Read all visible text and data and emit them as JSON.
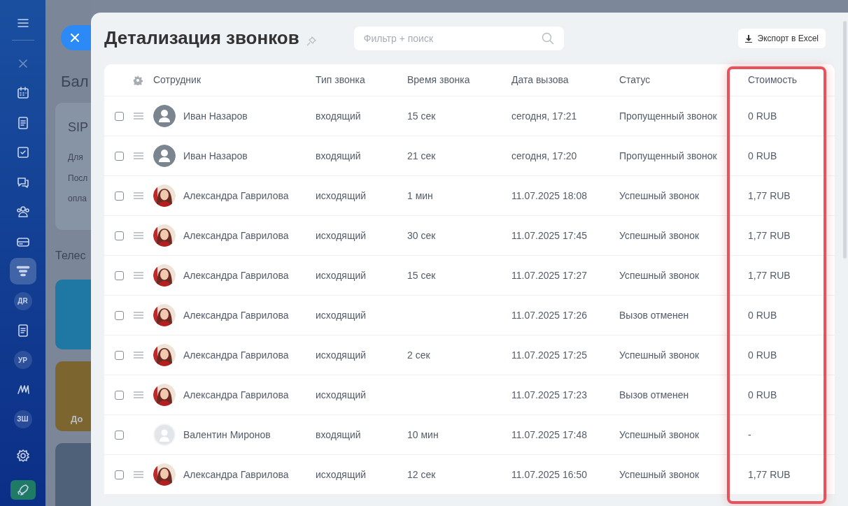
{
  "sidebar": {
    "items": [
      {
        "kind": "menu",
        "selected": false
      },
      {
        "kind": "close",
        "selected": false
      },
      {
        "kind": "calendar",
        "selected": false
      },
      {
        "kind": "document",
        "selected": false
      },
      {
        "kind": "checkbox",
        "selected": false
      },
      {
        "kind": "chat",
        "selected": false
      },
      {
        "kind": "people",
        "selected": false
      },
      {
        "kind": "card",
        "selected": false
      },
      {
        "kind": "funnel",
        "selected": true
      },
      {
        "kind": "initials",
        "text": "ДR",
        "selected": false
      },
      {
        "kind": "document",
        "selected": false
      },
      {
        "kind": "initials",
        "text": "УР",
        "selected": false
      },
      {
        "kind": "wave",
        "selected": false
      },
      {
        "kind": "initials",
        "text": "ЗШ",
        "selected": false
      },
      {
        "kind": "settings",
        "selected": false
      },
      {
        "kind": "rocket",
        "selected": false
      }
    ]
  },
  "background_page": {
    "title": "Бал",
    "card": {
      "title": "SIP",
      "lines": [
        "Для",
        "Посл",
        "опла"
      ]
    },
    "section_title": "Телес",
    "tiles": [
      {
        "color": "#1f77a3"
      },
      {
        "color": "#7d6530",
        "label": "До"
      },
      {
        "color": "#4f6178"
      }
    ]
  },
  "slider": {
    "title": "Детализация звонков",
    "search": {
      "placeholder": "Фильтр + поиск"
    },
    "export_button": "Экспорт в Excel"
  },
  "table": {
    "columns": [
      {
        "label": "Сотрудник",
        "highlighted": false
      },
      {
        "label": "Тип звонка",
        "highlighted": false
      },
      {
        "label": "Время звонка",
        "highlighted": false
      },
      {
        "label": "Дата вызова",
        "highlighted": false
      },
      {
        "label": "Статус",
        "highlighted": false
      },
      {
        "label": "Стоимость",
        "highlighted": true
      }
    ],
    "rows": [
      {
        "checked": false,
        "draggable": true,
        "avatar": {
          "kind": "placeholder"
        },
        "employee": "Иван Назаров",
        "type": "входящий",
        "duration": "15 сек",
        "date": "сегодня, 17:21",
        "status": "Пропущенный звонок",
        "cost": "0 RUB"
      },
      {
        "checked": false,
        "draggable": true,
        "avatar": {
          "kind": "placeholder"
        },
        "employee": "Иван Назаров",
        "type": "входящий",
        "duration": "21 сек",
        "date": "сегодня, 17:20",
        "status": "Пропущенный звонок",
        "cost": "0 RUB"
      },
      {
        "checked": false,
        "draggable": true,
        "employee": "Александра Гаврилова",
        "type": "исходящий",
        "duration": "1 мин",
        "date": "11.07.2025 18:08",
        "status": "Успешный звонок",
        "cost": "1,77 RUB"
      },
      {
        "checked": false,
        "draggable": true,
        "employee": "Александра Гаврилова",
        "type": "исходящий",
        "duration": "30 сек",
        "date": "11.07.2025 17:45",
        "status": "Успешный звонок",
        "cost": "1,77 RUB"
      },
      {
        "checked": false,
        "draggable": true,
        "employee": "Александра Гаврилова",
        "type": "исходящий",
        "duration": "15 сек",
        "date": "11.07.2025 17:27",
        "status": "Успешный звонок",
        "cost": "1,77 RUB"
      },
      {
        "checked": false,
        "draggable": true,
        "employee": "Александра Гаврилова",
        "type": "исходящий",
        "date": "11.07.2025 17:26",
        "status": "Вызов отменен",
        "cost": "0 RUB"
      },
      {
        "checked": false,
        "draggable": true,
        "employee": "Александра Гаврилова",
        "type": "исходящий",
        "duration": "2 сек",
        "date": "11.07.2025 17:25",
        "status": "Успешный звонок",
        "cost": "0 RUB"
      },
      {
        "checked": false,
        "draggable": true,
        "employee": "Александра Гаврилова",
        "type": "исходящий",
        "date": "11.07.2025 17:23",
        "status": "Вызов отменен",
        "cost": "0 RUB"
      },
      {
        "checked": false,
        "draggable": false,
        "avatar": {
          "kind": "light"
        },
        "employee": "Валентин Миронов",
        "type": "входящий",
        "duration": "10 мин",
        "date": "11.07.2025 17:48",
        "status": "Успешный звонок",
        "cost": "-"
      },
      {
        "checked": false,
        "draggable": true,
        "employee": "Александра Гаврилова",
        "type": "исходящий",
        "duration": "12 сек",
        "date": "11.07.2025 16:50",
        "status": "Успешный звонок",
        "cost": "1,77 RUB"
      }
    ]
  }
}
